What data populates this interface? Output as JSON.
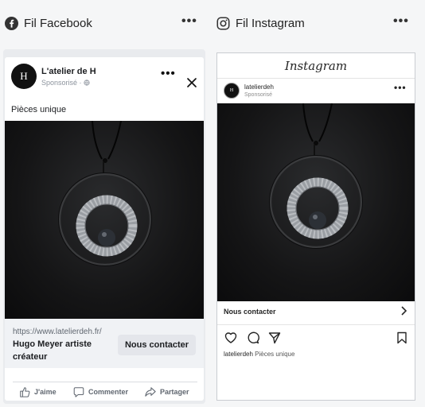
{
  "facebook_column": {
    "title": "Fil Facebook",
    "more_icon": "more-horizontal-icon",
    "post": {
      "avatar_text": "H",
      "page_name": "L'atelier de H",
      "sponsored": "Sponsorisé · ",
      "caption": "Pièces unique",
      "link_url": "https://www.latelierdeh.fr/",
      "headline": "Hugo Meyer artiste créateur",
      "cta": "Nous contacter",
      "actions": {
        "like": "J'aime",
        "comment": "Commenter",
        "share": "Partager"
      }
    }
  },
  "instagram_column": {
    "title": "Fil Instagram",
    "more_icon": "more-horizontal-icon",
    "post": {
      "logo": "Instagram",
      "avatar_text": "H",
      "username": "latelierdeh",
      "sponsored": "Sponsorisé",
      "cta": "Nous contacter",
      "caption_user": "latelierdeh",
      "caption_text": "Pièces unique"
    }
  },
  "colors": {
    "facebook_blue": "#1877f2",
    "background": "#f5f6f7",
    "image_dark": "#151516"
  }
}
